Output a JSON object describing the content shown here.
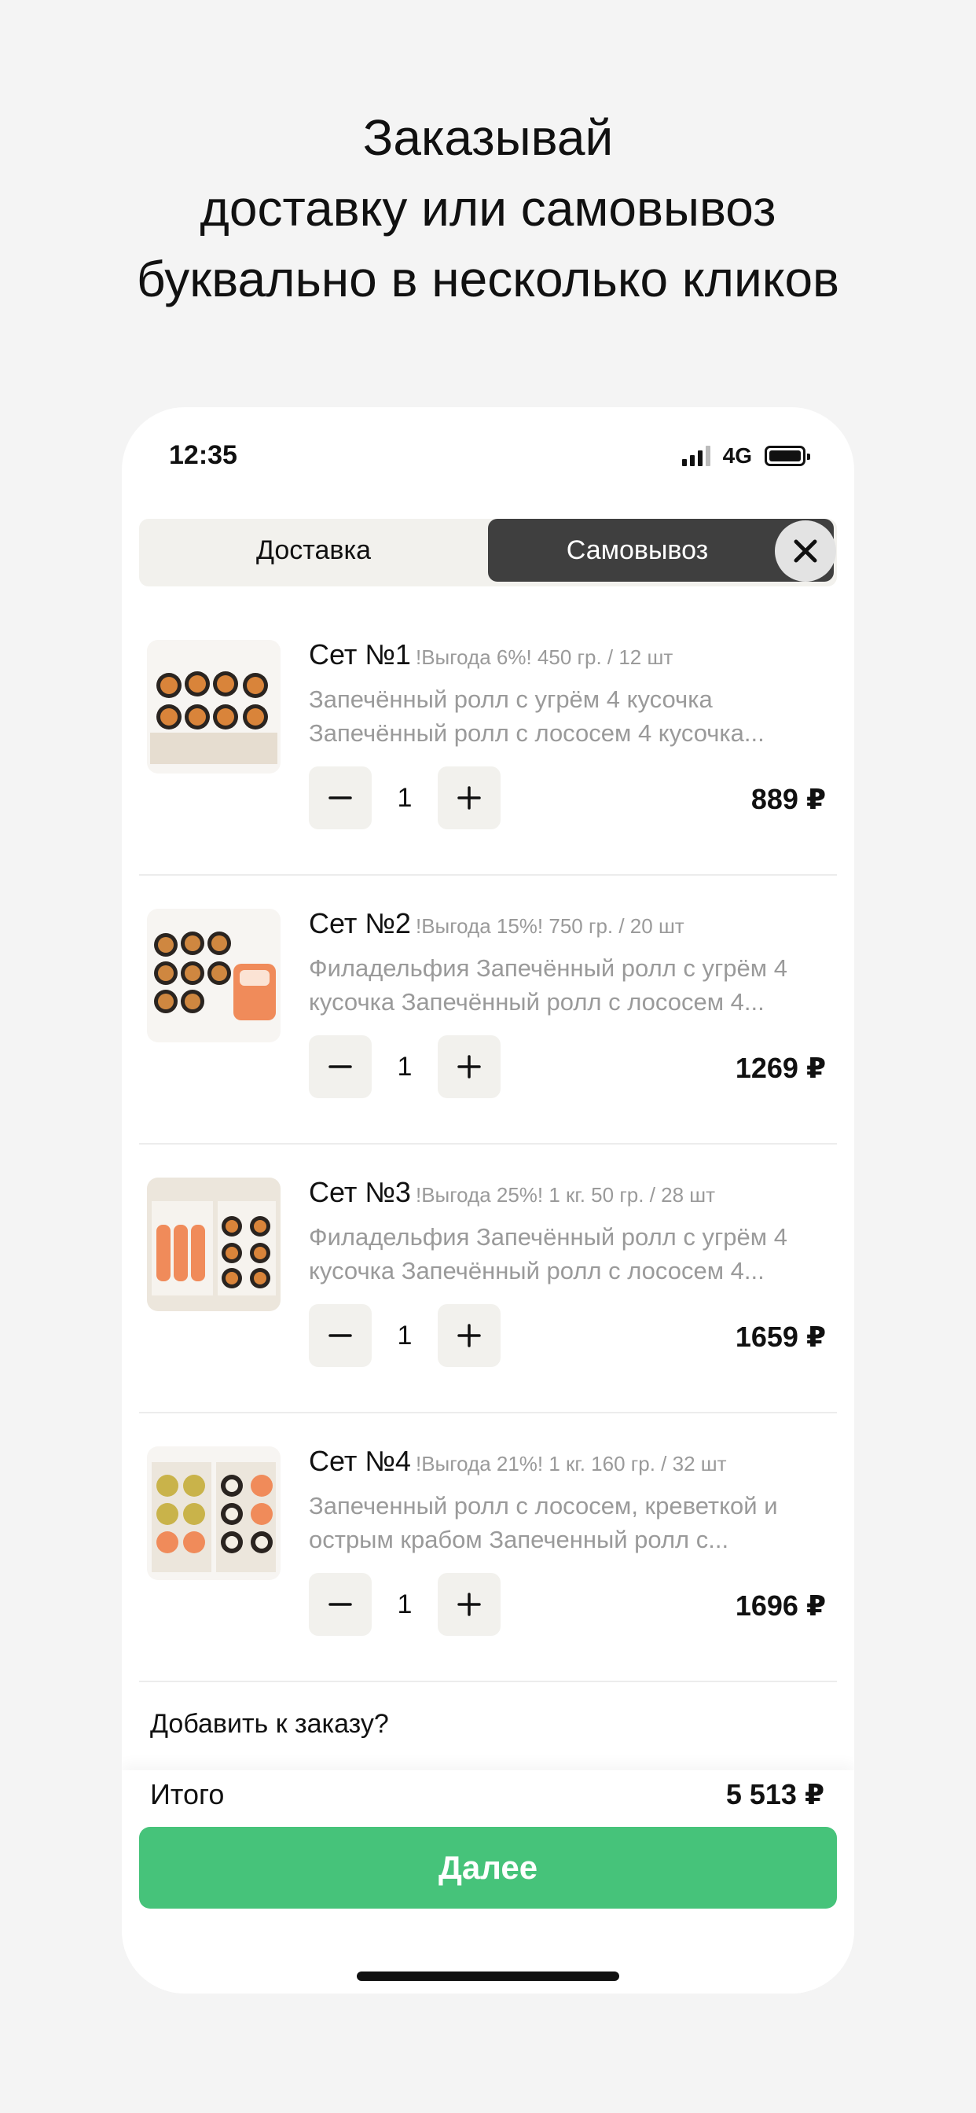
{
  "promo": {
    "line1": "Заказывай",
    "line2": "доставку или самовывоз",
    "line3": "буквально в несколько кликов"
  },
  "status_bar": {
    "time": "12:35",
    "network": "4G"
  },
  "mode": {
    "delivery_label": "Доставка",
    "pickup_label": "Самовывоз",
    "active": "pickup"
  },
  "cart": {
    "items": [
      {
        "name": "Сет №1",
        "meta": "!Выгода 6%! 450 гр. / 12 шт",
        "desc_line1": "Запечённый ролл с угрём 4 кусочка",
        "desc_line2": "Запечённый ролл с лососем 4 кусочка...",
        "qty": "1",
        "price": "889 ₽"
      },
      {
        "name": "Сет №2",
        "meta": "!Выгода 15%! 750 гр. / 20 шт",
        "desc_line1": "Филадельфия Запечённый ролл с угрём 4",
        "desc_line2": "кусочка Запечённый ролл с лососем 4...",
        "qty": "1",
        "price": "1269 ₽"
      },
      {
        "name": "Сет №3",
        "meta": "!Выгода 25%! 1 кг. 50 гр. / 28 шт",
        "desc_line1": "Филадельфия Запечённый ролл с угрём 4",
        "desc_line2": "кусочка Запечённый ролл с лососем 4...",
        "qty": "1",
        "price": "1659 ₽"
      },
      {
        "name": "Сет №4",
        "meta": "!Выгода 21%! 1 кг. 160 гр. / 32 шт",
        "desc_line1": "Запеченный ролл с лососем, креветкой и",
        "desc_line2": "острым крабом Запеченный ролл с...",
        "qty": "1",
        "price": "1696 ₽"
      }
    ]
  },
  "add_to_order": "Добавить к заказу?",
  "summary": {
    "total_label": "Итого",
    "total_value": "5 513 ₽",
    "next_label": "Далее"
  },
  "colors": {
    "accent_green": "#46c37a",
    "active_tab": "#3f3f3f",
    "muted_text": "#9a9a9a",
    "control_bg": "#f2f1ed"
  },
  "icons": [
    "close-icon",
    "minus-icon",
    "plus-icon",
    "signal-icon",
    "battery-icon"
  ]
}
